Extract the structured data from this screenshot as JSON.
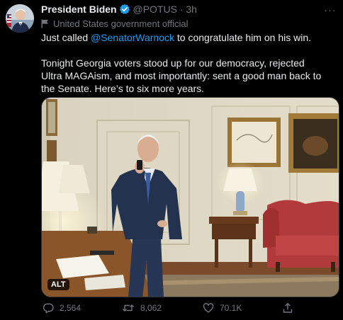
{
  "tweet": {
    "display_name": "President Biden",
    "handle": "@POTUS",
    "separator": "·",
    "time": "3h",
    "affiliation": "United States government official",
    "text_before_mention": "Just called ",
    "mention": "@SenatorWarnock",
    "text_after_mention": " to congratulate him on his win.",
    "paragraph_2": "Tonight Georgia voters stood up for our democracy, rejected Ultra MAGAism, and most importantly: sent a good man back to the Senate. Here’s to six more years.",
    "alt_badge": "ALT",
    "more_glyph": "···"
  },
  "actions": {
    "replies": "2,564",
    "retweets": "8,062",
    "likes": "70.1K"
  },
  "icons": {
    "verified": "verified-badge-icon",
    "affiliation": "flag-icon",
    "reply": "reply-icon",
    "retweet": "retweet-icon",
    "like": "heart-icon",
    "share": "share-icon",
    "more": "more-icon"
  },
  "colors": {
    "background": "#000000",
    "text": "#e7e9ea",
    "muted": "#71767b",
    "accent": "#1d9bf0"
  }
}
